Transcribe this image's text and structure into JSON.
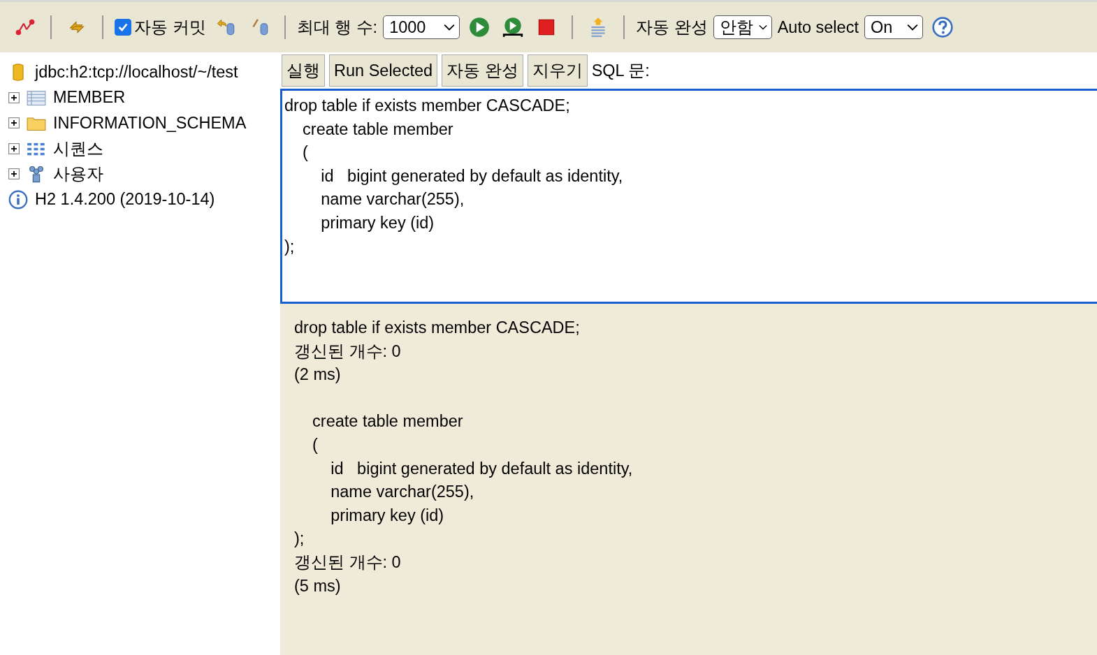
{
  "toolbar": {
    "auto_commit": {
      "label": "자동 커밋",
      "checked": true
    },
    "max_rows": {
      "label": "최대 행 수:",
      "value": "1000"
    },
    "autocomplete": {
      "label": "자동 완성",
      "value": "안함"
    },
    "auto_select": {
      "label": "Auto select",
      "value": "On"
    }
  },
  "tree": [
    {
      "kind": "database",
      "label": "jdbc:h2:tcp://localhost/~/test"
    },
    {
      "kind": "table",
      "label": "MEMBER",
      "expanded": false
    },
    {
      "kind": "folder",
      "label": "INFORMATION_SCHEMA",
      "expanded": false
    },
    {
      "kind": "sequences",
      "label": "시퀀스",
      "expanded": false
    },
    {
      "kind": "users",
      "label": "사용자",
      "expanded": false
    },
    {
      "kind": "info",
      "label": "H2 1.4.200 (2019-10-14)"
    }
  ],
  "buttons": [
    "실행",
    "Run Selected",
    "자동 완성",
    "지우기"
  ],
  "sql_label": "SQL 문:",
  "editor_lines": [
    "drop table if exists member CASCADE;",
    "    create table member",
    "    (",
    "        id   bigint generated by default as identity,",
    "        name varchar(255),",
    "        primary key (id)",
    ");"
  ],
  "results": [
    [
      "drop table if exists member CASCADE;",
      "갱신된 개수: 0",
      "(2 ms)"
    ],
    [
      "    create table member",
      "    (",
      "        id   bigint generated by default as identity,",
      "        name varchar(255),",
      "        primary key (id)",
      ");",
      "갱신된 개수: 0",
      "(5 ms)"
    ]
  ]
}
